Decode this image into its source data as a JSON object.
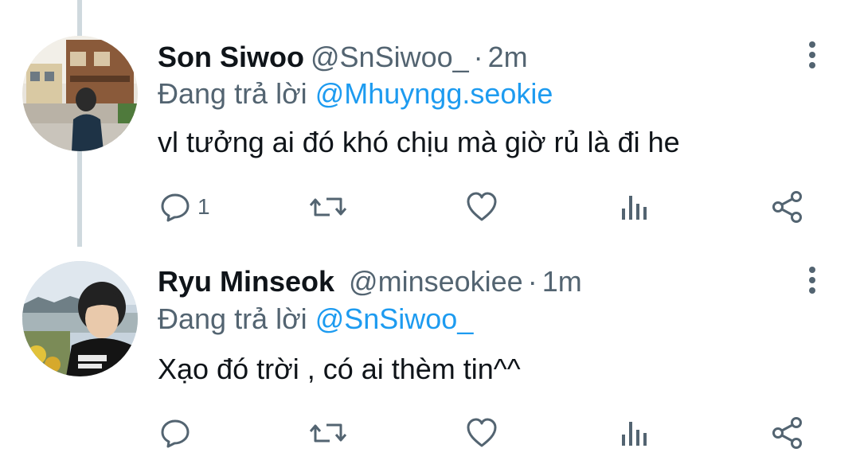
{
  "colors": {
    "link": "#1d9bf0",
    "secondary_text": "#536471",
    "primary_text": "#0f1419",
    "thread_line": "#cfd9de"
  },
  "tweets": [
    {
      "name": "Son Siwoo",
      "handle": "@SnSiwoo_",
      "separator": "·",
      "time": "2m",
      "replying_prefix": "Đang trả lời",
      "replying_to": "@Mhuyngg.seokie",
      "text": "vl tưởng ai đó khó chịu mà giờ rủ là đi he",
      "reply_count": "1",
      "icons": [
        "reply-icon",
        "retweet-icon",
        "like-icon",
        "analytics-icon",
        "share-icon",
        "more-options-icon"
      ]
    },
    {
      "name": "Ryu Minseok",
      "handle": "@minseokiee",
      "separator": "·",
      "time": "1m",
      "replying_prefix": "Đang trả lời",
      "replying_to": "@SnSiwoo_",
      "text": "Xạo đó trời , có ai thèm tin^^",
      "reply_count": "",
      "icons": [
        "reply-icon",
        "retweet-icon",
        "like-icon",
        "analytics-icon",
        "share-icon",
        "more-options-icon"
      ]
    }
  ]
}
